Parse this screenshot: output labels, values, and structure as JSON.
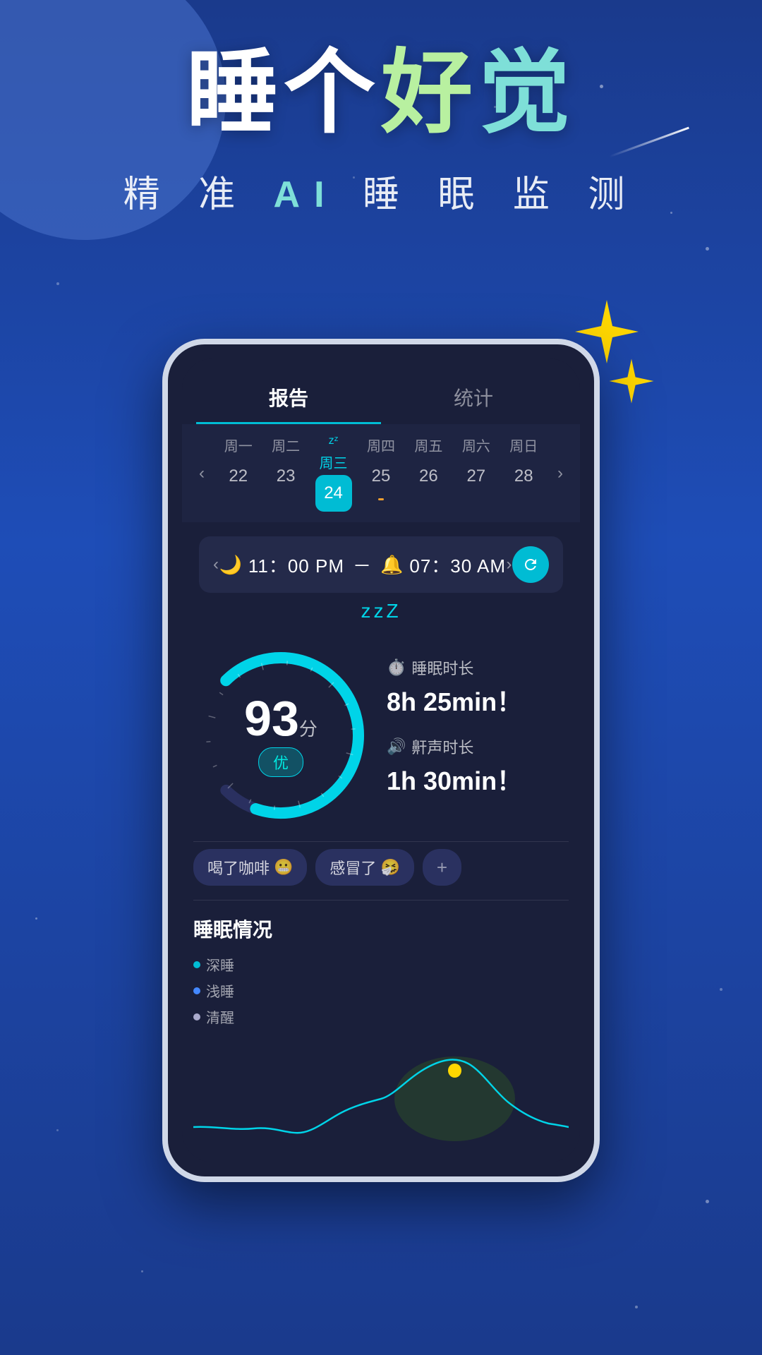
{
  "background": {
    "color_top": "#1a3a8c",
    "color_bottom": "#1a3a8c"
  },
  "header": {
    "title_white": "睡个",
    "title_green": "好",
    "title_teal": "觉",
    "subtitle": "精准 AI 睡眠监测"
  },
  "tabs": [
    {
      "id": "report",
      "label": "报告",
      "active": true
    },
    {
      "id": "stats",
      "label": "统计",
      "active": false
    }
  ],
  "week": {
    "days": [
      {
        "name": "周一",
        "num": "22",
        "active": false,
        "has_dot": false,
        "zzz": false
      },
      {
        "name": "周二",
        "num": "23",
        "active": false,
        "has_dot": false,
        "zzz": false
      },
      {
        "name": "周三",
        "num": "24",
        "active": true,
        "has_dot": false,
        "zzz": true
      },
      {
        "name": "周四",
        "num": "25",
        "active": false,
        "has_dot": true,
        "zzz": false
      },
      {
        "name": "周五",
        "num": "26",
        "active": false,
        "has_dot": false,
        "zzz": false
      },
      {
        "name": "周六",
        "num": "27",
        "active": false,
        "has_dot": false,
        "zzz": false
      },
      {
        "name": "周日",
        "num": "28",
        "active": false,
        "has_dot": false,
        "zzz": false
      }
    ]
  },
  "time_range": {
    "start": "11：00 PM",
    "end": "07：30 AM",
    "zzz": "zzZ"
  },
  "score": {
    "value": "93",
    "unit": "分",
    "grade": "优"
  },
  "stats": [
    {
      "icon": "⏱️",
      "label": "睡眠时长",
      "value": "8h 25min！"
    },
    {
      "icon": "🔊",
      "label": "鼾声时长",
      "value": "1h 30min！"
    }
  ],
  "tags": [
    {
      "label": "喝了咖啡",
      "emoji": "😬"
    },
    {
      "label": "感冒了",
      "emoji": "🤧"
    },
    {
      "label": "+",
      "emoji": ""
    }
  ],
  "sleep_chart": {
    "title": "睡眠情况",
    "legend": [
      {
        "label": "深睡",
        "color": "#00bcd4"
      },
      {
        "label": "浅睡",
        "color": "#4488ff"
      },
      {
        "label": "清醒",
        "color": "#aaaacc"
      }
    ]
  }
}
